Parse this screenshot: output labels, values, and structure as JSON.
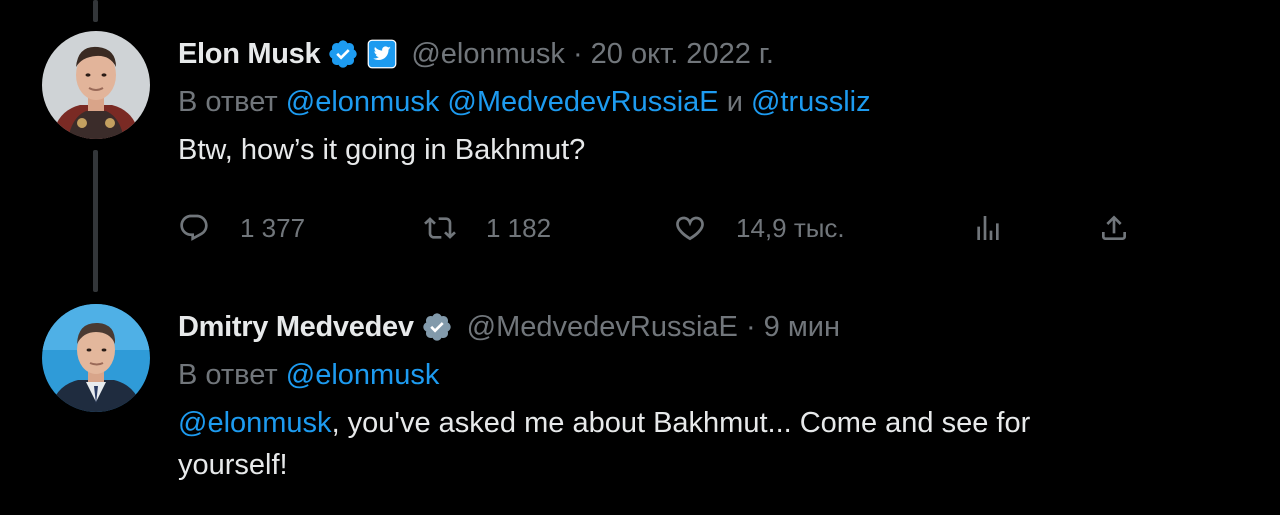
{
  "tweets": [
    {
      "author": {
        "name": "Elon Musk",
        "verified_icon": "verified-badge-icon",
        "affiliation_icon": "twitter-bird-badge-icon",
        "handle": "@elonmusk",
        "separator": " · ",
        "timestamp": "20 окт. 2022 г."
      },
      "replying": {
        "prefix": "В ответ",
        "mention_1": "@elonmusk",
        "mention_2": "@MedvedevRussiaE",
        "conjunction": "и",
        "mention_3": "@trussliz"
      },
      "text": "Btw, how’s it going in Bakhmut?",
      "actions": {
        "replies": "1 377",
        "retweets": "1 182",
        "likes": "14,9 тыс.",
        "views_icon": "analytics-icon",
        "share_icon": "share-icon"
      }
    },
    {
      "author": {
        "name": "Dmitry Medvedev",
        "verified_icon": "gray-verified-badge-icon",
        "handle": "@MedvedevRussiaE",
        "separator": " · ",
        "timestamp": "9 мин"
      },
      "replying": {
        "prefix": "В ответ",
        "mention_1": "@elonmusk"
      },
      "text_mention": "@elonmusk",
      "text_line_1": ", you've asked me about Bakhmut... Come and see for",
      "text_line_2": "yourself!"
    }
  ],
  "colors": {
    "background": "#000000",
    "text": "#e7e9ea",
    "secondary": "#71767b",
    "link": "#1d9bf0",
    "verified_blue": "#1d9bf0",
    "verified_gray": "#829aab"
  }
}
